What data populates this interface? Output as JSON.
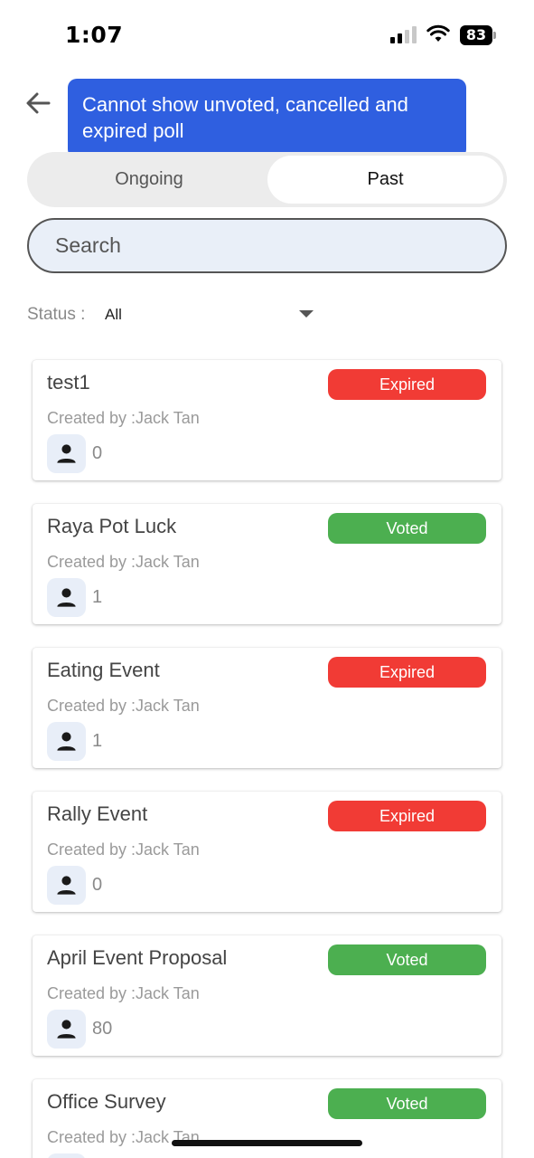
{
  "status_bar": {
    "time": "1:07",
    "battery": "83"
  },
  "toast": {
    "message": "Cannot show unvoted, cancelled and expired poll"
  },
  "tabs": [
    {
      "label": "Ongoing",
      "selected": false
    },
    {
      "label": "Past",
      "selected": true
    }
  ],
  "search": {
    "placeholder": "Search"
  },
  "filter": {
    "label": "Status :",
    "value": "All"
  },
  "polls": [
    {
      "title": "test1",
      "status": "Expired",
      "creator": "Created by :Jack Tan",
      "participants": "0"
    },
    {
      "title": "Raya Pot Luck",
      "status": "Voted",
      "creator": "Created by :Jack Tan",
      "participants": "1"
    },
    {
      "title": "Eating Event",
      "status": "Expired",
      "creator": "Created by :Jack Tan",
      "participants": "1"
    },
    {
      "title": "Rally Event",
      "status": "Expired",
      "creator": "Created by :Jack Tan",
      "participants": "0"
    },
    {
      "title": "April Event Proposal",
      "status": "Voted",
      "creator": "Created by :Jack Tan",
      "participants": "80"
    },
    {
      "title": "Office Survey",
      "status": "Voted",
      "creator": "Created by :Jack Tan",
      "participants": ""
    }
  ],
  "colors": {
    "expired": "#f13b35",
    "voted": "#4caf50",
    "toast": "#2f5fe0"
  }
}
